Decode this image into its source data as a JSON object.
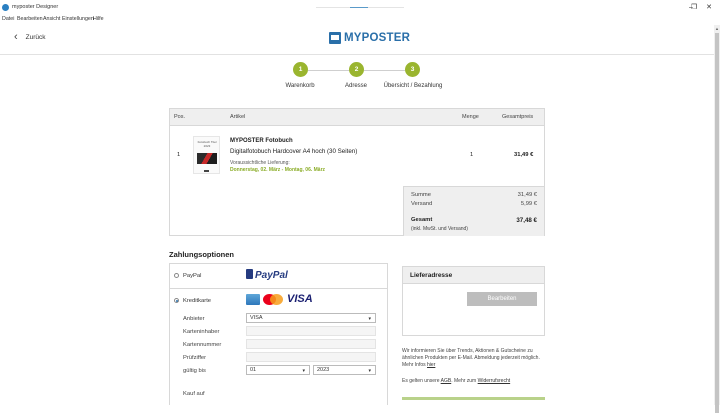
{
  "window": {
    "title": "myposter Designer",
    "minimize": "–",
    "maximize": "❐",
    "close": "✕"
  },
  "menu": [
    "Datei",
    "Bearbeiten",
    "Ansicht",
    "Einstellungen",
    "Hilfe"
  ],
  "header": {
    "back_label": "Zurück",
    "logo_text": "MYPOSTER"
  },
  "steps": [
    {
      "number": "1",
      "label": "Warenkorb"
    },
    {
      "number": "2",
      "label": "Adresse"
    },
    {
      "number": "3",
      "label": "Übersicht / Bezahlung"
    }
  ],
  "cart": {
    "headers": {
      "pos": "Pos.",
      "article": "Artikel",
      "qty": "Menge",
      "total": "Gesamtpreis"
    },
    "item": {
      "pos": "1",
      "thumb_text": "Fotobuch Titel 2023",
      "name": "MYPOSTER Fotobuch",
      "description": "Digitalfotobuch Hardcover A4 hoch (30 Seiten)",
      "delivery_label": "Voraussichtliche Lieferung:",
      "delivery_date": "Donnerstag, 02. März - Montag, 06. März",
      "qty": "1",
      "price": "31,49 €"
    },
    "summary": {
      "sum_label": "Summe",
      "sum_value": "31,49 €",
      "shipping_label": "Versand",
      "shipping_value": "5,99 €",
      "total_label": "Gesamt",
      "total_value": "37,48 €",
      "total_note": "(inkl. MwSt. und Versand)"
    }
  },
  "payment": {
    "title": "Zahlungsoptionen",
    "paypal_label": "PayPal",
    "paypal_logo": "PayPal",
    "card_label": "Kreditkarte",
    "visa_logo": "VISA",
    "form": {
      "provider_label": "Anbieter",
      "provider_value": "VISA",
      "holder_label": "Karteninhaber",
      "number_label": "Kartennummer",
      "cvc_label": "Prüfziffer",
      "valid_label": "gültig bis",
      "month_value": "01",
      "year_value": "2023",
      "next_label": "Kauf auf"
    }
  },
  "delivery": {
    "title": "Lieferadresse",
    "edit_button": "Bearbeiten"
  },
  "notes": {
    "newsletter": "Wir informieren Sie über Trends, Aktionen & Gutscheine zu ähnlichen Produkten per E-Mail. Abmeldung jederzeit möglich. Mehr Infos",
    "newsletter_link": "hier",
    "terms_prefix": "Es gelten unsere",
    "terms_agb": "AGB",
    "terms_middle": ". Mehr zum",
    "terms_link": "Widerrufsrecht"
  },
  "colors": {
    "step_green": "#9ab52f",
    "delivery_green": "#8aac27",
    "brand_blue": "#2a6fa9",
    "paypal_dark": "#253b80",
    "paypal_light": "#179bd7",
    "visa_blue": "#1a1f71"
  }
}
